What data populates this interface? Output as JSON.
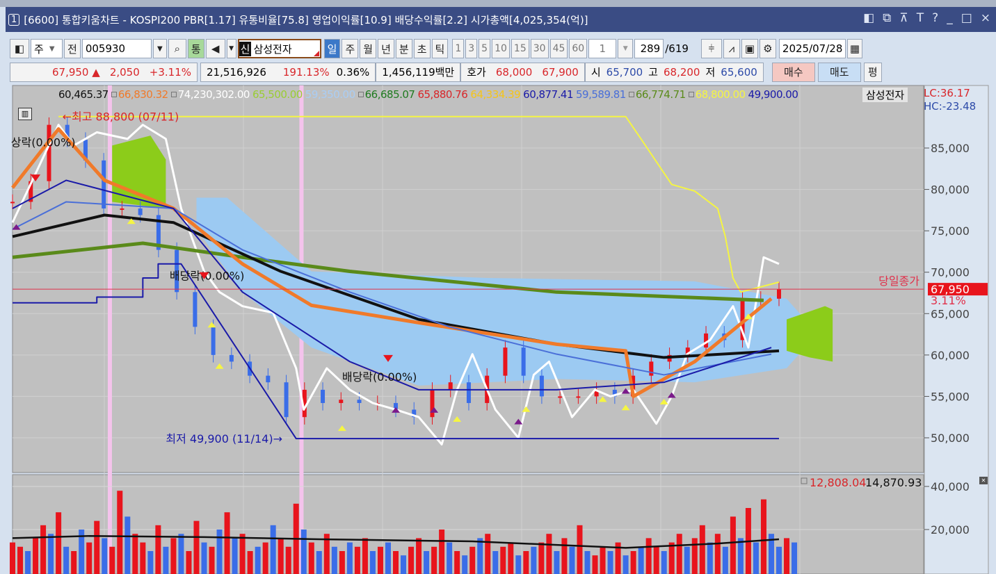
{
  "window": {
    "index": "1",
    "title": "[6600] 통합키움차트 - KOSPI200 PBR[1.17] 유통비율[75.8] 영업이익률[10.9] 배당수익률[2.2] 시가총액[4,025,354(억)]",
    "controls": [
      "◧",
      "⧉",
      "⊼",
      "T",
      "?",
      "_",
      "□",
      "×"
    ]
  },
  "toolbar": {
    "market": "주",
    "prev": "전",
    "code": "005930",
    "tong": "통",
    "new_badge": "신",
    "stock_name": "삼성전자",
    "periods": [
      "일",
      "주",
      "월",
      "년",
      "분",
      "초",
      "틱"
    ],
    "active_period": "일",
    "intervals": [
      "1",
      "3",
      "5",
      "10",
      "15",
      "30",
      "45",
      "60"
    ],
    "interval_value": "1",
    "count": "289",
    "total": "/619",
    "date": "2025/07/28"
  },
  "quote": {
    "price": "67,950",
    "arrow": "▲",
    "change": "2,050",
    "change_pct": "+3.11%",
    "volume": "21,516,926",
    "vol_ratio": "191.13%",
    "turnover": "0.36%",
    "amount": "1,456,119백만",
    "hoga_label": "호가",
    "ask": "68,000",
    "bid": "67,900",
    "open_label": "시",
    "open": "65,700",
    "high_label": "고",
    "high": "68,200",
    "low_label": "저",
    "low": "65,600",
    "buy": "매수",
    "sell": "매도",
    "avg": "평"
  },
  "legend": [
    {
      "v": "60,465.37",
      "c": "#111111"
    },
    {
      "v": "66,830.32",
      "c": "#f07a2a",
      "sq": true
    },
    {
      "v": "74,230,302.00",
      "c": "#ffffff",
      "sq": true
    },
    {
      "v": "65,500.00",
      "c": "#9acd32"
    },
    {
      "v": "59,350.00",
      "c": "#a9cdf5"
    },
    {
      "v": "66,685.07",
      "c": "#1f7a1f",
      "sq": true
    },
    {
      "v": "65,880.76",
      "c": "#d8262a"
    },
    {
      "v": "64,334.39",
      "c": "#f5c518"
    },
    {
      "v": "60,877.41",
      "c": "#1a1aa8"
    },
    {
      "v": "59,589.81",
      "c": "#4a6fd8"
    },
    {
      "v": "66,774.71",
      "c": "#5a8a1a",
      "sq": true
    },
    {
      "v": "68,800.00",
      "c": "#f5f542",
      "sq": true
    },
    {
      "v": "49,900.00",
      "c": "#1a1aa8"
    }
  ],
  "legend_stock": "삼성전자",
  "lc": "LC:36.17",
  "hc": "HC:-23.48",
  "colors": {
    "up": "#e8141c",
    "down": "#3a6de8",
    "bg": "#c0c0c0",
    "axis_bg": "#dbe5f1"
  },
  "chart_data": {
    "type": "line",
    "title": "삼성전자 일봉",
    "ylim": [
      47500,
      90500
    ],
    "yticks": [
      50000,
      55000,
      60000,
      65000,
      70000,
      75000,
      80000,
      85000
    ],
    "ytick_labels": [
      "50,000",
      "55,000",
      "60,000",
      "65,000",
      "70,000",
      "75,000",
      "80,000",
      "85,000"
    ],
    "x_days": [
      0,
      119
    ],
    "closes": [
      78500,
      81000,
      87800,
      86000,
      83500,
      77700,
      77700,
      76900,
      72700,
      67600,
      63400,
      60000,
      59200,
      57500,
      56700,
      52500,
      55800,
      54200,
      54600,
      54200,
      54200,
      53400,
      52500,
      55800,
      56700,
      54200,
      57500,
      60900,
      57500,
      55000,
      55000,
      55000,
      55800,
      55000,
      57500,
      59200,
      60000,
      60900,
      62600,
      61800,
      66800,
      66800,
      67950
    ],
    "series": [
      {
        "name": "lagging",
        "color": "#ffffff",
        "width": 3,
        "points": [
          [
            0,
            76000
          ],
          [
            6,
            87800
          ],
          [
            8,
            85300
          ],
          [
            11,
            86900
          ],
          [
            15,
            86100
          ],
          [
            17,
            87800
          ],
          [
            20,
            86100
          ],
          [
            22,
            77700
          ],
          [
            25,
            70100
          ],
          [
            27,
            67600
          ],
          [
            30,
            65900
          ],
          [
            34,
            65100
          ],
          [
            37,
            58400
          ],
          [
            38,
            53400
          ],
          [
            41,
            58400
          ],
          [
            44,
            55800
          ],
          [
            47,
            54200
          ],
          [
            50,
            53400
          ],
          [
            53,
            52500
          ],
          [
            56,
            49200
          ],
          [
            58,
            55800
          ],
          [
            60,
            60100
          ],
          [
            63,
            53400
          ],
          [
            66,
            50000
          ],
          [
            68,
            57600
          ],
          [
            70,
            59200
          ],
          [
            73,
            52500
          ],
          [
            76,
            55800
          ],
          [
            78,
            55000
          ],
          [
            81,
            55800
          ],
          [
            84,
            51700
          ],
          [
            86,
            55000
          ],
          [
            88,
            60100
          ],
          [
            91,
            61800
          ],
          [
            94,
            65900
          ],
          [
            96,
            60900
          ],
          [
            98,
            71800
          ],
          [
            100,
            71000
          ]
        ]
      },
      {
        "name": "ma-green",
        "color": "#5a8a1a",
        "width": 5,
        "points": [
          [
            0,
            71800
          ],
          [
            17,
            73500
          ],
          [
            30,
            71800
          ],
          [
            44,
            70100
          ],
          [
            71,
            67600
          ],
          [
            98,
            66600
          ]
        ]
      },
      {
        "name": "ma-black",
        "color": "#111111",
        "width": 4,
        "points": [
          [
            0,
            74300
          ],
          [
            12,
            76900
          ],
          [
            21,
            76000
          ],
          [
            35,
            70100
          ],
          [
            53,
            64300
          ],
          [
            71,
            61300
          ],
          [
            85,
            59700
          ],
          [
            100,
            60500
          ]
        ]
      },
      {
        "name": "ma-orange",
        "color": "#f07a2a",
        "width": 5,
        "points": [
          [
            0,
            80200
          ],
          [
            6,
            87300
          ],
          [
            12,
            81100
          ],
          [
            21,
            77700
          ],
          [
            30,
            71000
          ],
          [
            39,
            66000
          ],
          [
            53,
            63900
          ],
          [
            71,
            61300
          ],
          [
            80,
            60500
          ],
          [
            81,
            55000
          ],
          [
            89,
            59200
          ],
          [
            99,
            66800
          ]
        ]
      },
      {
        "name": "ma-lightblue",
        "color": "#4a6fd8",
        "width": 2,
        "points": [
          [
            0,
            75200
          ],
          [
            7,
            78500
          ],
          [
            21,
            77700
          ],
          [
            30,
            72700
          ],
          [
            44,
            67600
          ],
          [
            57,
            63400
          ],
          [
            71,
            60100
          ],
          [
            85,
            57600
          ],
          [
            99,
            60100
          ]
        ]
      },
      {
        "name": "ma-darkblue",
        "color": "#1a1aa8",
        "width": 2,
        "points": [
          [
            0,
            77700
          ],
          [
            7,
            81100
          ],
          [
            21,
            77700
          ],
          [
            30,
            67600
          ],
          [
            44,
            59200
          ],
          [
            53,
            55800
          ],
          [
            71,
            55800
          ],
          [
            85,
            56700
          ],
          [
            99,
            60900
          ]
        ]
      },
      {
        "name": "highest",
        "color": "#f5f542",
        "width": 2,
        "points": [
          [
            6,
            88800
          ],
          [
            80,
            88800
          ],
          [
            82,
            86100
          ],
          [
            86,
            80600
          ],
          [
            89,
            79800
          ],
          [
            92,
            77700
          ],
          [
            93,
            74300
          ],
          [
            94,
            69300
          ],
          [
            95,
            67600
          ],
          [
            100,
            68800
          ]
        ]
      },
      {
        "name": "lowest",
        "color": "#1a1aa8",
        "width": 2,
        "points": [
          [
            0,
            66300
          ],
          [
            11,
            66300
          ],
          [
            11,
            67000
          ],
          [
            17,
            67000
          ],
          [
            17,
            69300
          ],
          [
            19,
            69300
          ],
          [
            19,
            71000
          ],
          [
            22,
            71000
          ],
          [
            37,
            49900
          ],
          [
            100,
            49900
          ]
        ]
      }
    ],
    "clouds": [
      {
        "name": "cloud-blue",
        "color": "#9ccaf2",
        "points": [
          [
            24,
            79000
          ],
          [
            28,
            79000
          ],
          [
            39,
            70100
          ],
          [
            62,
            69300
          ],
          [
            89,
            68900
          ],
          [
            101,
            66800
          ],
          [
            105,
            62600
          ],
          [
            101,
            58400
          ],
          [
            89,
            56700
          ],
          [
            71,
            57100
          ],
          [
            53,
            56300
          ],
          [
            39,
            60900
          ],
          [
            30,
            67600
          ],
          [
            24,
            75200
          ]
        ]
      },
      {
        "name": "cloud-green-left",
        "color": "#8ccc1a",
        "points": [
          [
            13,
            85300
          ],
          [
            18,
            86500
          ],
          [
            20,
            83600
          ],
          [
            20,
            77700
          ],
          [
            13,
            78500
          ]
        ]
      },
      {
        "name": "cloud-green-right",
        "color": "#8ccc1a",
        "points": [
          [
            101,
            64300
          ],
          [
            106,
            65900
          ],
          [
            107,
            65500
          ],
          [
            107,
            59200
          ],
          [
            104,
            59700
          ],
          [
            101,
            60500
          ]
        ]
      }
    ],
    "event_lines": [
      12.7,
      37.7
    ],
    "annotations": [
      {
        "text": "←최고 88,800 (07/11)",
        "day": 6.5,
        "price": 88800,
        "color": "#d8262a"
      },
      {
        "text": "최저 49,900 (11/14)→",
        "day": 20,
        "price": 49900,
        "color": "#1a1aa8"
      },
      {
        "text": "배당락(0.00%)",
        "day": 20.5,
        "price": 69600,
        "color": "#111111"
      },
      {
        "text": "배당락(0.00%)",
        "day": 43,
        "price": 57400,
        "color": "#111111"
      },
      {
        "text": "상락(0.00%)",
        "day": -0.2,
        "price": 85700,
        "color": "#111111"
      }
    ],
    "current": {
      "label": "당일종가",
      "price": 67950,
      "price_label": "67,950",
      "pct_label": "3.11%"
    },
    "volume": {
      "ylim": [
        0,
        46000
      ],
      "yticks": [
        20000,
        40000
      ],
      "ytick_labels": [
        "20,000",
        "40,000"
      ],
      "legend": [
        "12,808.04",
        "14,870.93"
      ],
      "values": [
        14,
        12,
        -10,
        16,
        22,
        -18,
        28,
        -12,
        10,
        -20,
        14,
        24,
        -16,
        12,
        38,
        -26,
        18,
        14,
        -10,
        22,
        -12,
        16,
        -18,
        10,
        24,
        -14,
        12,
        -20,
        28,
        -16,
        18,
        10,
        -12,
        14,
        -22,
        16,
        12,
        32,
        -20,
        14,
        -10,
        18,
        -12,
        10,
        -14,
        12,
        16,
        -10,
        12,
        -14,
        10,
        -8,
        12,
        16,
        -10,
        12,
        20,
        -14,
        10,
        -8,
        12,
        -16,
        18,
        -10,
        12,
        14,
        -8,
        10,
        -12,
        14,
        18,
        -10,
        16,
        -12,
        22,
        -10,
        8,
        12,
        -10,
        14,
        -8,
        10,
        -12,
        16,
        12,
        -10,
        14,
        18,
        -12,
        16,
        22,
        -14,
        18,
        -12,
        26,
        -16,
        30,
        -14,
        34,
        -18,
        -12,
        16,
        -14
      ],
      "ma": [
        [
          0,
          16000
        ],
        [
          10,
          17000
        ],
        [
          25,
          16500
        ],
        [
          40,
          15500
        ],
        [
          60,
          14500
        ],
        [
          80,
          11500
        ],
        [
          92,
          13500
        ],
        [
          100,
          15500
        ]
      ]
    }
  }
}
